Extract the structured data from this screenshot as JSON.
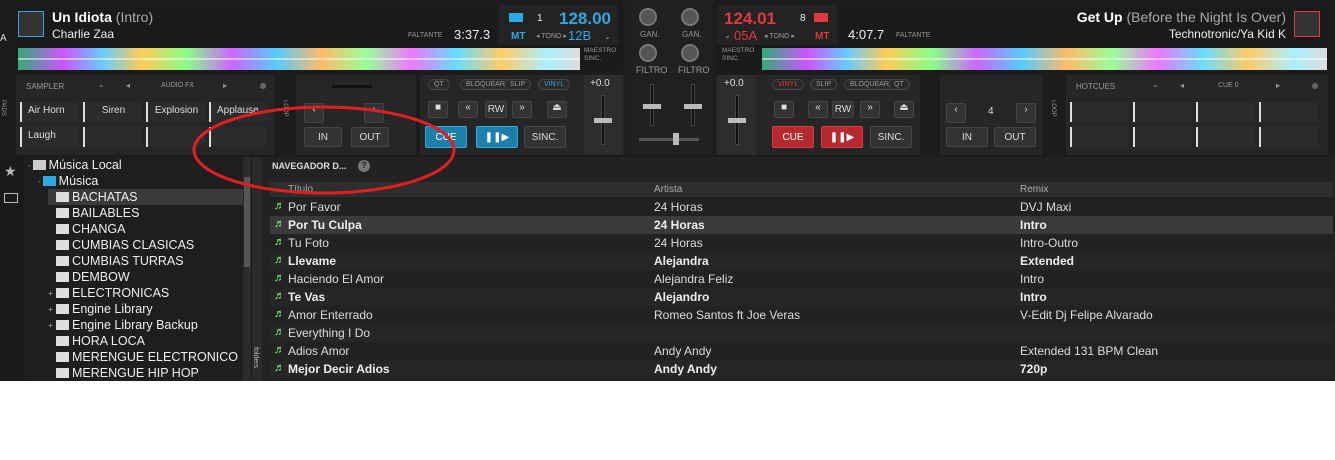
{
  "left_deck": {
    "title": "Un Idiota",
    "title_sub": "(Intro)",
    "artist": "Charlie Zaa",
    "remaining_label": "FALTANTE",
    "time": "3:37.3",
    "deck_num": "1",
    "bpm": "128.00",
    "mt": "MT",
    "tono": "TONO",
    "key": "12B",
    "master": "MAESTRO",
    "sync": "SINC."
  },
  "right_deck": {
    "title": "Get Up",
    "title_sub": "(Before the Night Is Over)",
    "artist": "Technotronic/Ya Kid K",
    "remaining_label": "FALTANTE",
    "time": "4:07.7",
    "deck_num": "8",
    "bpm": "124.01",
    "mt": "MT",
    "tono": "TONO",
    "key": "05A",
    "master": "MAESTRO",
    "sync": "SINC."
  },
  "mixer": {
    "gain": "GAN.",
    "filter": "FILTRO"
  },
  "left_panel": {
    "sampler": "SAMPLER",
    "audio_fx": "AUDIO FX",
    "pads": [
      "Air Horn",
      "Siren",
      "Explosion",
      "Applause",
      "Laugh"
    ],
    "pads_label": "PADS",
    "loop": "LOOP",
    "in": "IN",
    "out": "OUT",
    "cue": "CUE",
    "sync": "SINC.",
    "pitch": "+0.0",
    "qt": "QT",
    "bloquear": "BLOQUEAR",
    "slip": "SLIP",
    "vinyl": "VINYL",
    "rw": "RW"
  },
  "right_panel": {
    "hotcues": "HOTCUES",
    "cue0": "CUE 0",
    "loop_size": "4",
    "in": "IN",
    "out": "OUT",
    "cue": "CUE",
    "sync": "SINC.",
    "pitch": "+0.0",
    "vinyl": "VINYL",
    "slip": "SLIP",
    "bloquear": "BLOQUEAR",
    "qt": "QT",
    "rw": "RW",
    "loop": "LOOP"
  },
  "tree": {
    "root": "Música Local",
    "music": "Música",
    "folders": [
      "BACHATAS",
      "BAILABLES",
      "CHANGA",
      "CUMBIAS CLASICAS",
      "CUMBIAS TURRAS",
      "DEMBOW",
      "ELECTRONICAS",
      "Engine Library",
      "Engine Library Backup",
      "HORA LOCA",
      "MERENGUE ELECTRONICO",
      "MERENGUE HIP HOP"
    ]
  },
  "browser": {
    "title": "NAVEGADOR D...",
    "folders_tab": "folders",
    "columns": [
      "Título",
      "Artista",
      "Remix"
    ],
    "rows": [
      {
        "title": "Por Favor",
        "artist": "24 Horas",
        "remix": "DVJ Maxi"
      },
      {
        "title": "Por Tu Culpa",
        "artist": "24 Horas",
        "remix": "Intro"
      },
      {
        "title": "Tu Foto",
        "artist": "24 Horas",
        "remix": "Intro-Outro"
      },
      {
        "title": "Llevame",
        "artist": "Alejandra",
        "remix": "Extended"
      },
      {
        "title": "Haciendo El Amor",
        "artist": "Alejandra Feliz",
        "remix": "Intro"
      },
      {
        "title": "Te Vas",
        "artist": "Alejandro",
        "remix": "Intro"
      },
      {
        "title": "Amor Enterrado",
        "artist": "Romeo Santos ft Joe Veras",
        "remix": "V-Edit Dj Felipe Alvarado"
      },
      {
        "title": "Everything I Do",
        "artist": "",
        "remix": ""
      },
      {
        "title": "Adios Amor",
        "artist": "Andy Andy",
        "remix": "Extended 131 BPM Clean"
      },
      {
        "title": "Mejor Decir Adios",
        "artist": "Andy Andy",
        "remix": "720p"
      }
    ]
  },
  "colors": {
    "accent_blue": "#2ea8e5",
    "accent_red": "#e0393e",
    "annotation": "#e02020"
  }
}
